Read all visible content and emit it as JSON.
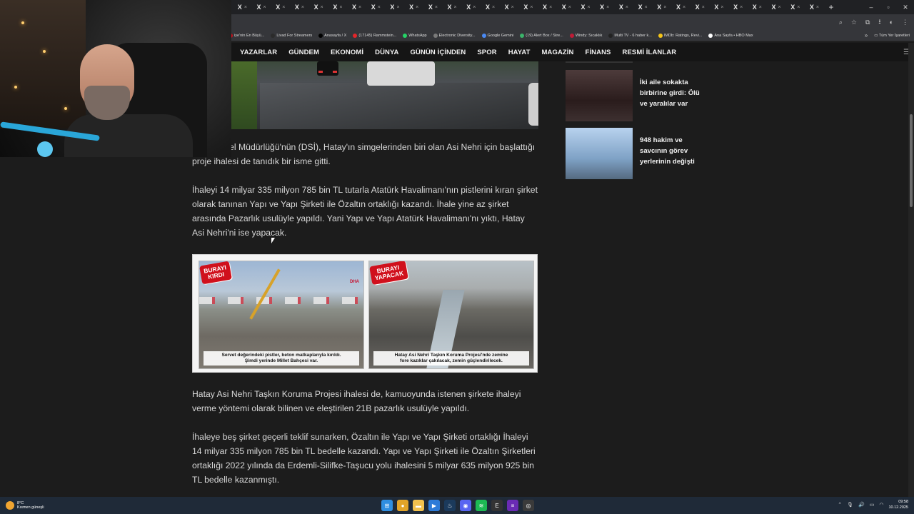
{
  "browser": {
    "tab_glyph": "X",
    "tab_count": 31,
    "newtab": "+",
    "window_controls": [
      "–",
      "▫",
      "✕"
    ],
    "bookmarks": [
      {
        "label": "iye'nin En Büyü...",
        "color": "#d0101c"
      },
      {
        "label": "Livad For Streamers",
        "color": "#2b2b2b"
      },
      {
        "label": "Anasayfa / X",
        "color": "#000000"
      },
      {
        "label": "(17145) Rammstein...",
        "color": "#e3262a"
      },
      {
        "label": "WhatsApp",
        "color": "#25d366"
      },
      {
        "label": "Electronic Diversity...",
        "color": "#7a7a7a"
      },
      {
        "label": "Google Gemini",
        "color": "#4a8af4"
      },
      {
        "label": "(19) Alert Box / Stre...",
        "color": "#3bb36a"
      },
      {
        "label": "Windy: Sıcaklık",
        "color": "#c01b36"
      },
      {
        "label": "Multi TV - 6 haber k...",
        "color": "#222222"
      },
      {
        "label": "IMDb: Ratings, Revi...",
        "color": "#f5c518"
      },
      {
        "label": "Ana Sayfa • HBO Max",
        "color": "#ffffff"
      }
    ],
    "bookmarks_more": "»",
    "all_bookmarks": "Tüm Yer İşaretleri"
  },
  "nav": {
    "items": [
      "YAZARLAR",
      "GÜNDEM",
      "EKONOMİ",
      "DÜNYA",
      "GÜNÜN İÇİNDEN",
      "SPOR",
      "HAYAT",
      "MAGAZİN",
      "FİNANS",
      "RESMİ İLANLAR"
    ]
  },
  "article": {
    "p1": "İşleri Genel Müdürlüğü'nün (DSİ), Hatay'ın simgelerinden biri olan Asi Nehri için başlattığı proje ihalesi de tanıdık bir isme gitti.",
    "p2": "İhaleyi 14 milyar 335 milyon 785 bin TL tutarla Atatürk Havalimanı'nın pistlerini kıran şirket olarak tanınan Yapı ve Yapı Şirketi ile Özaltın ortaklığı kazandı. İhale yine az şirket arasında Pazarlık usulüyle yapıldı. Yani Yapı ve Yapı Atatürk Havalimanı'nı yıktı, Hatay Asi Nehri'ni ise yapacak.",
    "p3": "Hatay Asi Nehri Taşkın Koruma Projesi ihalesi de, kamuoyunda istenen şirkete ihaleyi verme yöntemi olarak bilinen ve eleştirilen 21B pazarlık usulüyle yapıldı.",
    "p4": "İhaleye beş şirket geçerli teklif sunarken, Özaltın ile Yapı ve Yapı Şirketi ortaklığı İhaleyi 14 milyar 335 milyon 785 bin TL bedelle kazandı. Yapı ve Yapı Şirketi ile Özaltın Şirketleri ortaklığı 2022 yılında da Erdemli-Silifke-Taşucu yolu ihalesini 5 milyar 635 milyon 925 bin TL bedelle kazanmıştı."
  },
  "figure": {
    "left_badge": "BURAYI\nKIRDI",
    "left_caption": "Servet değerindeki pistler, beton matkaplarıyla kırıldı.\nŞimdi yerinde Millet Bahçesi var.",
    "left_watermark": "DHA",
    "right_badge": "BURAYI\nYAPACAK",
    "right_caption": "Hatay Asi Nehri Taşkın Koruma Projesi'nde zemine\nfore kazıklar çakılacak, zemin güçlendirilecek."
  },
  "sidebar": {
    "items": [
      {
        "title": "İki aile sokakta birbirine girdi: Ölü ve yaralılar var"
      },
      {
        "title": "948 hakim ve savcının görev yerlerinin değişti"
      }
    ]
  },
  "taskbar": {
    "temp": "8°C",
    "weather": "Kısmen güneşli",
    "time": "09:58",
    "date": "10.12.2025",
    "apps": [
      {
        "icon": "windows-icon",
        "color": "#2f8ee0",
        "glyph": "⊞"
      },
      {
        "icon": "chrome-icon",
        "color": "#e2a429",
        "glyph": "●"
      },
      {
        "icon": "folder-icon",
        "color": "#f2c14e",
        "glyph": "▬"
      },
      {
        "icon": "media-icon",
        "color": "#2d7bd8",
        "glyph": "▶"
      },
      {
        "icon": "steam-icon",
        "color": "#1b3a5c",
        "glyph": "♨"
      },
      {
        "icon": "discord-icon",
        "color": "#5865f2",
        "glyph": "◉"
      },
      {
        "icon": "spotify-icon",
        "color": "#1db954",
        "glyph": "≋"
      },
      {
        "icon": "epic-icon",
        "color": "#333333",
        "glyph": "E"
      },
      {
        "icon": "sleeves-icon",
        "color": "#6a2bb5",
        "glyph": "≡"
      },
      {
        "icon": "obs-icon",
        "color": "#3a3a3a",
        "glyph": "◎"
      }
    ]
  }
}
